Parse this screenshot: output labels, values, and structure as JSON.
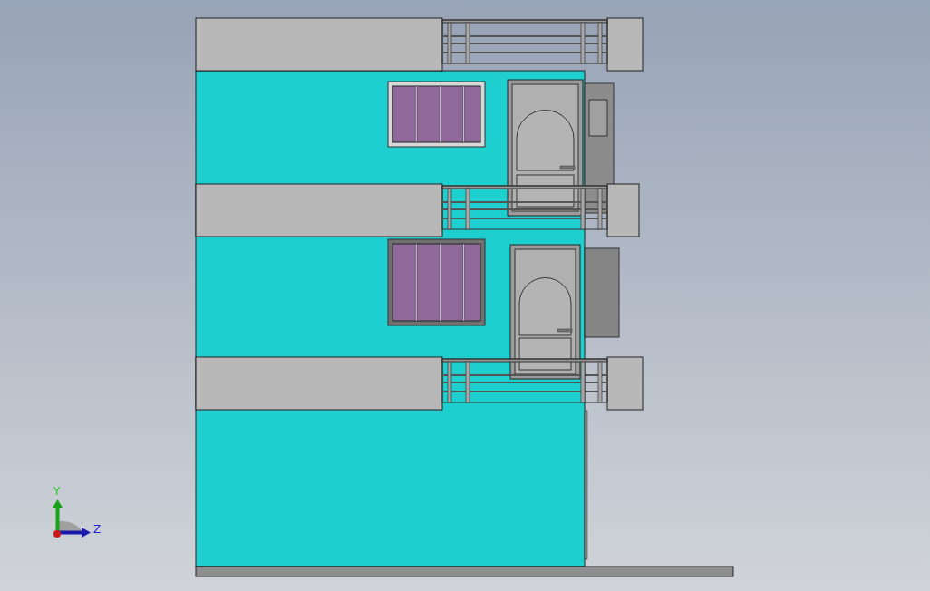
{
  "viewport": {
    "triad": [
      {
        "kind": "y",
        "label": "Y"
      },
      {
        "kind": "z",
        "label": "Z"
      }
    ]
  }
}
